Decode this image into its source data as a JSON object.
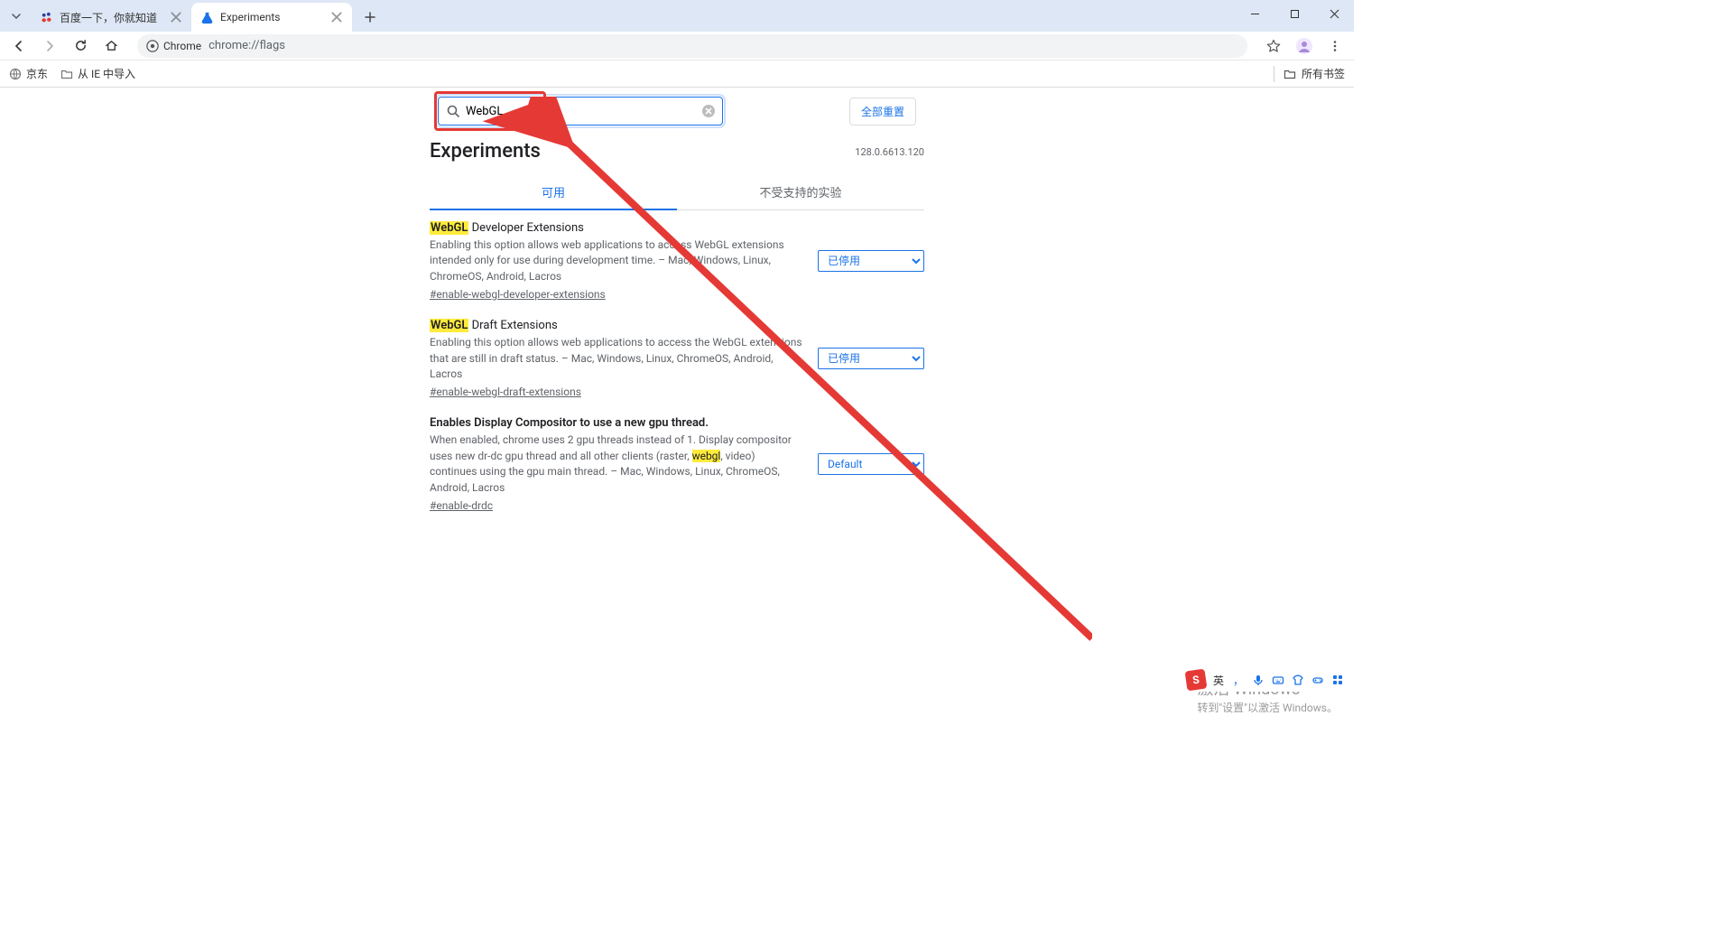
{
  "window": {
    "tabs": [
      {
        "title": "百度一下，你就知道",
        "active": false
      },
      {
        "title": "Experiments",
        "active": true
      }
    ]
  },
  "toolbar": {
    "chrome_chip_label": "Chrome",
    "url": "chrome://flags"
  },
  "bookmarks": {
    "items": [
      {
        "label": "京东"
      },
      {
        "label": "从 IE 中导入"
      }
    ],
    "all_label": "所有书签"
  },
  "flags_page": {
    "search_value": "WebGL",
    "reset_label": "全部重置",
    "heading": "Experiments",
    "version": "128.0.6613.120",
    "tab_available": "可用",
    "tab_unavailable": "不受支持的实验",
    "dropdown_disabled": "已停用",
    "dropdown_default": "Default",
    "experiments": [
      {
        "title_hl": "WebGL",
        "title_rest": " Developer Extensions",
        "desc": "Enabling this option allows web applications to access WebGL extensions intended only for use during development time. – Mac, Windows, Linux, ChromeOS, Android, Lacros",
        "hash": "#enable-webgl-developer-extensions",
        "state": "已停用"
      },
      {
        "title_hl": "WebGL",
        "title_rest": " Draft Extensions",
        "desc": "Enabling this option allows web applications to access the WebGL extensions that are still in draft status. – Mac, Windows, Linux, ChromeOS, Android, Lacros",
        "hash": "#enable-webgl-draft-extensions",
        "state": "已停用"
      },
      {
        "title_plain": "Enables Display Compositor to use a new gpu thread.",
        "desc_pre": "When enabled, chrome uses 2 gpu threads instead of 1. Display compositor uses new dr-dc gpu thread and all other clients (raster, ",
        "desc_hl": "webgl",
        "desc_post": ", video) continues using the gpu main thread. – Mac, Windows, Linux, ChromeOS, Android, Lacros",
        "hash": "#enable-drdc",
        "state": "Default"
      }
    ]
  },
  "watermark": {
    "line1": "激活 Windows",
    "line2": "转到\"设置\"以激活 Windows。"
  },
  "ime": {
    "lang": "英",
    "punct": "，"
  }
}
